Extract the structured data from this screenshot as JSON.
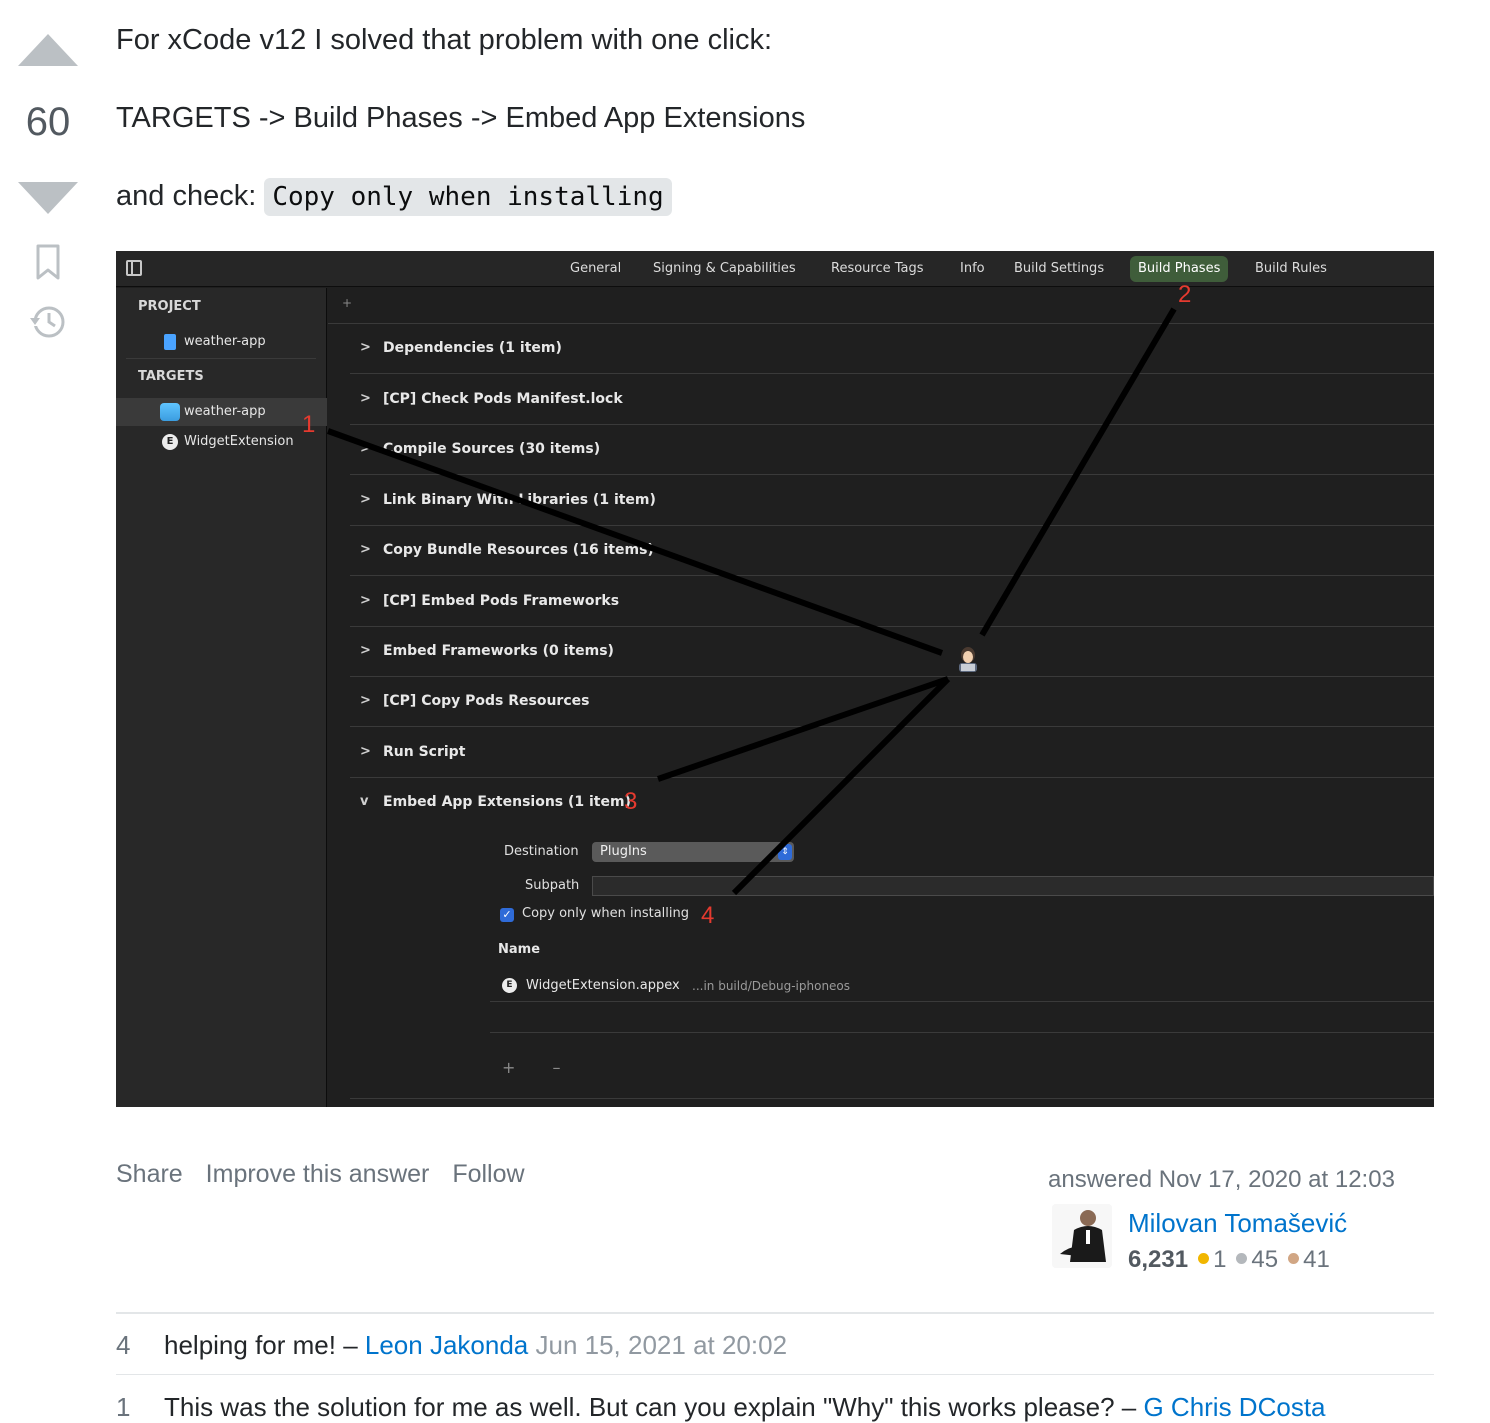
{
  "vote": {
    "count": "60"
  },
  "body": {
    "p1": "For xCode v12 I solved that problem with one click:",
    "p2": "TARGETS -> Build Phases -> Embed App Extensions",
    "p3_prefix": "and check: ",
    "p3_code": "Copy only when installing"
  },
  "screenshot": {
    "tabs": [
      "General",
      "Signing & Capabilities",
      "Resource Tags",
      "Info",
      "Build Settings",
      "Build Phases",
      "Build Rules"
    ],
    "active_tab": "Build Phases",
    "sidebar": {
      "project_header": "PROJECT",
      "project_item": "weather-app",
      "targets_header": "TARGETS",
      "target_items": [
        "weather-app",
        "WidgetExtension"
      ],
      "ext_glyph": "E"
    },
    "add_glyph": "+",
    "phases": [
      "Dependencies (1 item)",
      "[CP] Check Pods Manifest.lock",
      "Compile Sources (30 items)",
      "Link Binary With Libraries (1 item)",
      "Copy Bundle Resources (16 items)",
      "[CP] Embed Pods Frameworks",
      "Embed Frameworks (0 items)",
      "[CP] Copy Pods Resources",
      "Run Script",
      "Embed App Extensions (1 item)"
    ],
    "chevron_closed": ">",
    "chevron_open": "v",
    "destination_label": "Destination",
    "destination_value": "PlugIns",
    "subpath_label": "Subpath",
    "copy_only_label": "Copy only when installing",
    "name_header": "Name",
    "file_name": "WidgetExtension.appex",
    "file_path": "...in build/Debug-iphoneos",
    "add_remove": "+ –",
    "annotations": [
      "1",
      "2",
      "3",
      "4"
    ]
  },
  "post_menu": {
    "share": "Share",
    "improve": "Improve this answer",
    "follow": "Follow"
  },
  "user": {
    "answered": "answered Nov 17, 2020 at 12:03",
    "name": "Milovan Tomašević",
    "reputation": "6,231",
    "gold": "1",
    "silver": "45",
    "bronze": "41",
    "badge_colors": {
      "gold": "#f1b600",
      "silver": "#b4b8bc",
      "bronze": "#d1a684"
    }
  },
  "comments": [
    {
      "score": "4",
      "text": "helping for me! – ",
      "author": "Leon Jakonda",
      "date": " Jun 15, 2021 at 20:02"
    },
    {
      "score": "1",
      "text": "This was the solution for me as well. But can you explain \"Why\" this works please? – ",
      "author": "G Chris DCosta",
      "date": ""
    }
  ]
}
